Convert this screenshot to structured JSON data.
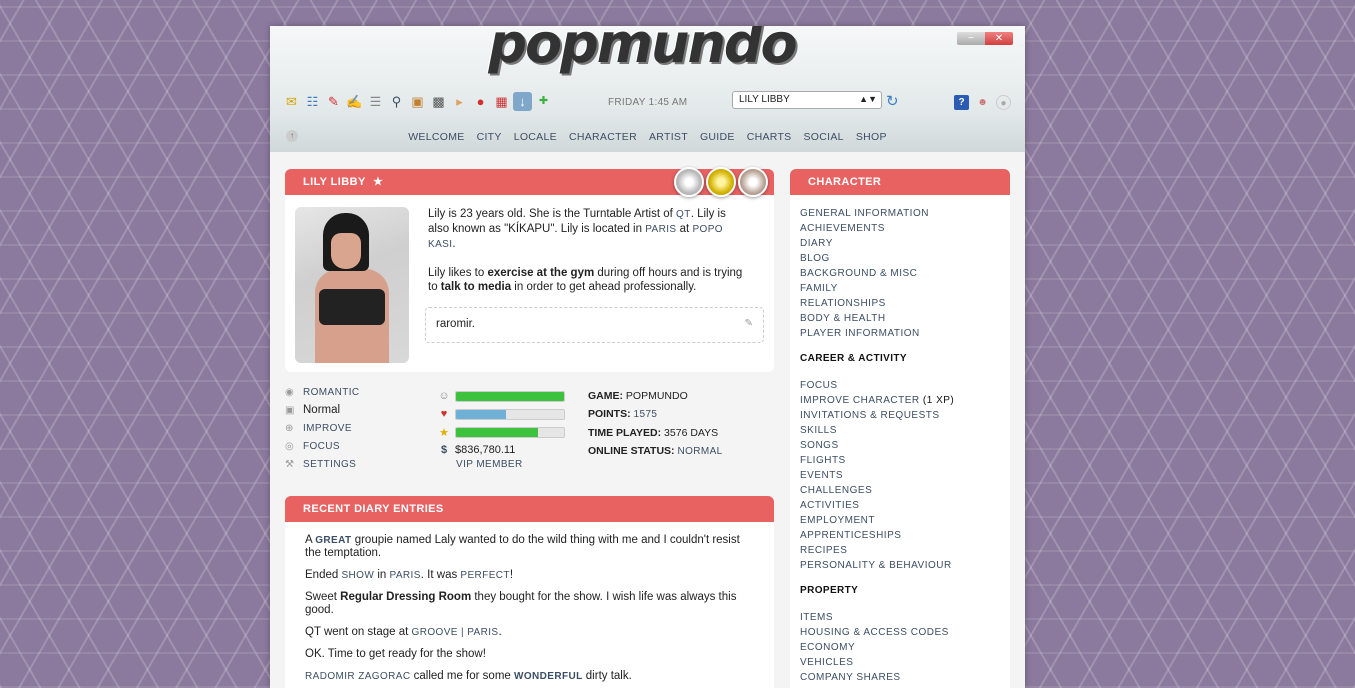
{
  "app": {
    "logo": "popmundo"
  },
  "header": {
    "clock": "FRIDAY 1:45 AM",
    "character_select": "LILY LIBBY",
    "toolbar_icons": [
      "notes-icon",
      "network-icon",
      "pencil-icon",
      "edit-icon",
      "book-icon",
      "search-icon",
      "box-icon",
      "camera-icon",
      "bandage-icon",
      "apple-icon",
      "shop-icon",
      "download-icon",
      "plus-icon"
    ],
    "nav": [
      "WELCOME",
      "CITY",
      "LOCALE",
      "CHARACTER",
      "ARTIST",
      "GUIDE",
      "CHARTS",
      "SOCIAL",
      "SHOP"
    ]
  },
  "profile": {
    "name": "LILY LIBBY",
    "bio": {
      "t1": "Lily is 23 years old. She is the Turntable Artist of ",
      "band": "QT",
      "t2": ". Lily is also known as \"KÍKAPU\". Lily is located in ",
      "city": "PARIS",
      "t3": " at ",
      "locale": "POPO KASI",
      "t4": ".",
      "t5": "Lily likes to ",
      "b1": "exercise at the gym",
      "t6": " during off hours and is trying to ",
      "b2": "talk to media",
      "t7": " in order to get ahead professionally."
    },
    "note": "raromir."
  },
  "actions": {
    "romantic": "ROMANTIC",
    "mood": "Normal",
    "improve": "IMPROVE",
    "focus": "FOCUS",
    "settings": "SETTINGS"
  },
  "meters": {
    "mood_level": 1.0,
    "health_level": 0.46,
    "star_level": 0.76,
    "colors": {
      "mood": "#3cc23c",
      "health": "#6fb0d6",
      "star": "#3cc23c"
    },
    "money": "$836,780.11",
    "vip": "VIP MEMBER"
  },
  "stats": {
    "game_k": "GAME:",
    "game_v": "POPMUNDO",
    "points_k": "POINTS:",
    "points_v": "1575",
    "time_k": "TIME PLAYED:",
    "time_v": "3576 DAYS",
    "online_k": "ONLINE STATUS:",
    "online_v": "NORMAL"
  },
  "diary": {
    "title": "RECENT DIARY ENTRIES",
    "e1": {
      "a": "A ",
      "great": "GREAT",
      "b": " groupie named Laly wanted to do the wild thing with me and I couldn't resist the temptation."
    },
    "e2": {
      "a": "Ended ",
      "show": "SHOW",
      "b": " in ",
      "paris": "PARIS",
      "c": ". It was ",
      "perfect": "PERFECT",
      "d": "!"
    },
    "e3": {
      "a": "Sweet ",
      "room": "Regular Dressing Room",
      "b": " they bought for the show. I wish life was always this good."
    },
    "e4": {
      "a": "QT went on stage at ",
      "venue": "GROOVE | PARIS",
      "b": "."
    },
    "e5": "OK. Time to get ready for the show!",
    "e6": {
      "who": "RADOMIR ZAGORAC",
      "a": " called me for some ",
      "wonderful": "WONDERFUL",
      "b": " dirty talk."
    }
  },
  "sidebar": {
    "title": "CHARACTER",
    "character_items": [
      "GENERAL INFORMATION",
      "ACHIEVEMENTS",
      "DIARY",
      "BLOG",
      "BACKGROUND & MISC",
      "FAMILY",
      "RELATIONSHIPS",
      "BODY & HEALTH",
      "PLAYER INFORMATION"
    ],
    "career_head": "CAREER & ACTIVITY",
    "career_items": [
      "FOCUS",
      "IMPROVE CHARACTER",
      "INVITATIONS & REQUESTS",
      "SKILLS",
      "SONGS",
      "FLIGHTS",
      "EVENTS",
      "CHALLENGES",
      "ACTIVITIES",
      "EMPLOYMENT",
      "APPRENTICESHIPS",
      "RECIPES",
      "PERSONALITY & BEHAVIOUR"
    ],
    "improve_extra": " (1 XP)",
    "property_head": "PROPERTY",
    "property_items": [
      "ITEMS",
      "HOUSING & ACCESS CODES",
      "ECONOMY",
      "VEHICLES",
      "COMPANY SHARES"
    ]
  }
}
